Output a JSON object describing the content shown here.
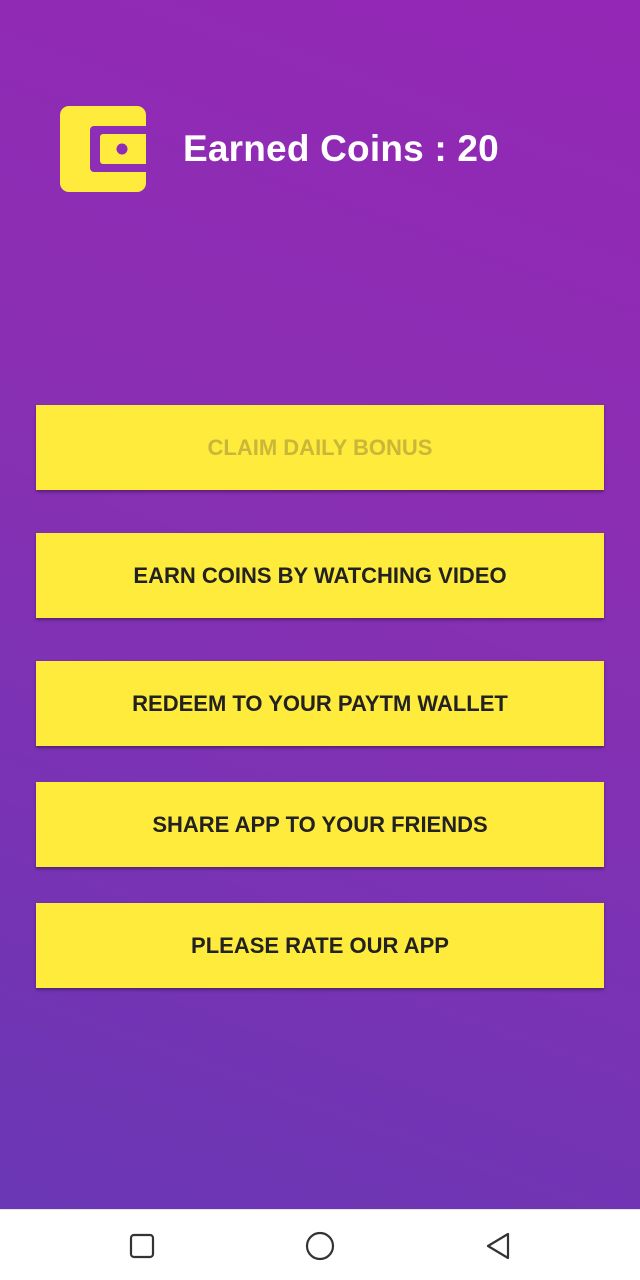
{
  "header": {
    "icon": "wallet-icon",
    "coins_label": "Earned Coins : 20"
  },
  "buttons": [
    {
      "label": "CLAIM DAILY BONUS",
      "state": "disabled"
    },
    {
      "label": "EARN COINS BY WATCHING VIDEO",
      "state": "enabled"
    },
    {
      "label": "REDEEM TO YOUR PAYTM WALLET",
      "state": "enabled"
    },
    {
      "label": "SHARE APP TO YOUR FRIENDS",
      "state": "enabled"
    },
    {
      "label": "PLEASE RATE OUR APP",
      "state": "enabled"
    }
  ],
  "navbar": {
    "icons": [
      "recents-square-icon",
      "home-circle-icon",
      "back-triangle-icon"
    ]
  },
  "colors": {
    "background_top": "#9427b5",
    "background_bottom": "#6a37b5",
    "button": "#ffeb3b",
    "button_text": "#222222",
    "button_text_disabled": "#c9b73a",
    "header_text": "#ffffff",
    "navbar": "#ffffff"
  }
}
